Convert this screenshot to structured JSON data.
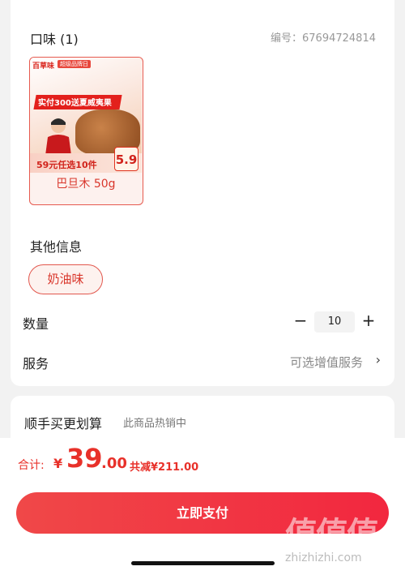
{
  "flavor": {
    "title": "口味 (1)",
    "code": "编号：67694724814",
    "sku": {
      "label": "巴旦木 50g",
      "image": {
        "brand": "百草味",
        "brand_tag": "超级品牌日",
        "banner": "实付300送夏威夷果",
        "deal": "59元任选10件",
        "price_tag": "5.9"
      }
    }
  },
  "other": {
    "title": "其他信息",
    "chip": "奶油味"
  },
  "quantity": {
    "label": "数量",
    "minus": "−",
    "value": "10",
    "plus": "+"
  },
  "service": {
    "label": "服务",
    "value": "可选增值服务",
    "chevron": "›"
  },
  "recommend": {
    "title": "顺手买更划算",
    "subtitle": "此商品热销中"
  },
  "footer": {
    "total_label": "合计:",
    "currency": "¥",
    "total_int": "39",
    "total_dec": ".00",
    "saving": "共减¥211.00",
    "pay_button": "立即支付"
  },
  "watermark": {
    "logo": "值值值",
    "site": "zhizhizhi.com"
  },
  "colors": {
    "accent": "#e8312a",
    "button": "#f2273f"
  }
}
